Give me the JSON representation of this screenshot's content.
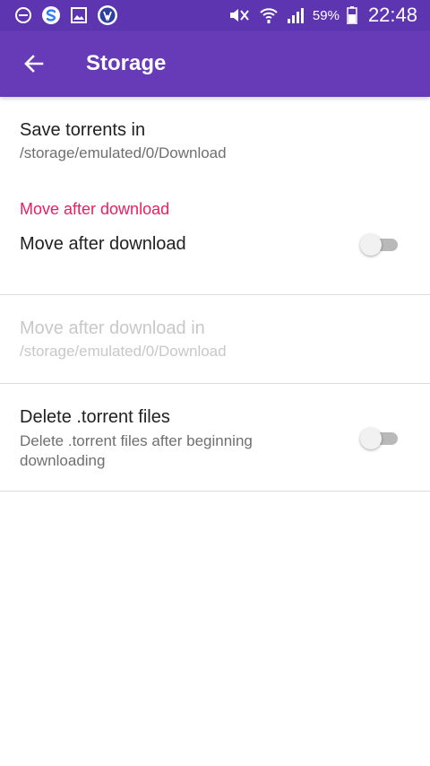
{
  "status_bar": {
    "battery_percent": "59%",
    "time": "22:48",
    "icons_left": [
      "do-not-disturb-icon",
      "sync-app-icon",
      "gallery-icon",
      "browser-app-icon"
    ],
    "icons_right": [
      "mute-icon",
      "wifi-icon",
      "signal-icon",
      "battery-icon"
    ]
  },
  "app_bar": {
    "title": "Storage",
    "back_icon": "arrow-back-icon",
    "color": "#673ab7",
    "status_color": "#5e35b1"
  },
  "prefs": {
    "save_torrents": {
      "title": "Save torrents in",
      "summary": "/storage/emulated/0/Download"
    },
    "category_move": {
      "title": "Move after download",
      "color": "#e91e63"
    },
    "move_after_download": {
      "title": "Move after download",
      "checked": false
    },
    "move_after_download_in": {
      "title": "Move after download in",
      "summary": "/storage/emulated/0/Download",
      "enabled": false
    },
    "delete_torrent_files": {
      "title": "Delete .torrent files",
      "summary": "Delete .torrent files after beginning downloading",
      "checked": false
    }
  }
}
